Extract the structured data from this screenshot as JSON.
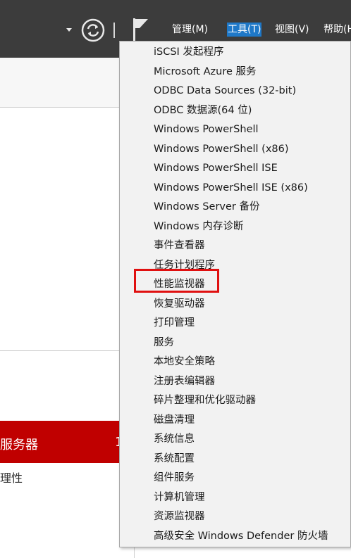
{
  "header": {
    "menus": [
      {
        "label": "管理(M)"
      },
      {
        "label": "工具(T)"
      },
      {
        "label": "视图(V)"
      },
      {
        "label": "帮助(H"
      }
    ]
  },
  "tools_menu": {
    "items": [
      "iSCSI 发起程序",
      "Microsoft Azure 服务",
      "ODBC Data Sources (32-bit)",
      "ODBC 数据源(64 位)",
      "Windows PowerShell",
      "Windows PowerShell (x86)",
      "Windows PowerShell ISE",
      "Windows PowerShell ISE (x86)",
      "Windows Server 备份",
      "Windows 内存诊断",
      "事件查看器",
      "任务计划程序",
      "性能监视器",
      "恢复驱动器",
      "打印管理",
      "服务",
      "本地安全策略",
      "注册表编辑器",
      "碎片整理和优化驱动器",
      "磁盘清理",
      "系统信息",
      "系统配置",
      "组件服务",
      "计算机管理",
      "资源监视器",
      "高级安全 Windows Defender 防火墙"
    ],
    "highlighted_item": "性能监视器"
  },
  "background": {
    "server_bar_label": "服务器",
    "server_bar_count": "1",
    "properties_label": "理性"
  },
  "colors": {
    "header_bg": "#3c3c3c",
    "active_menu_bg": "#1e78c8",
    "server_bar_bg": "#c00000",
    "highlight_border": "#e01010"
  }
}
